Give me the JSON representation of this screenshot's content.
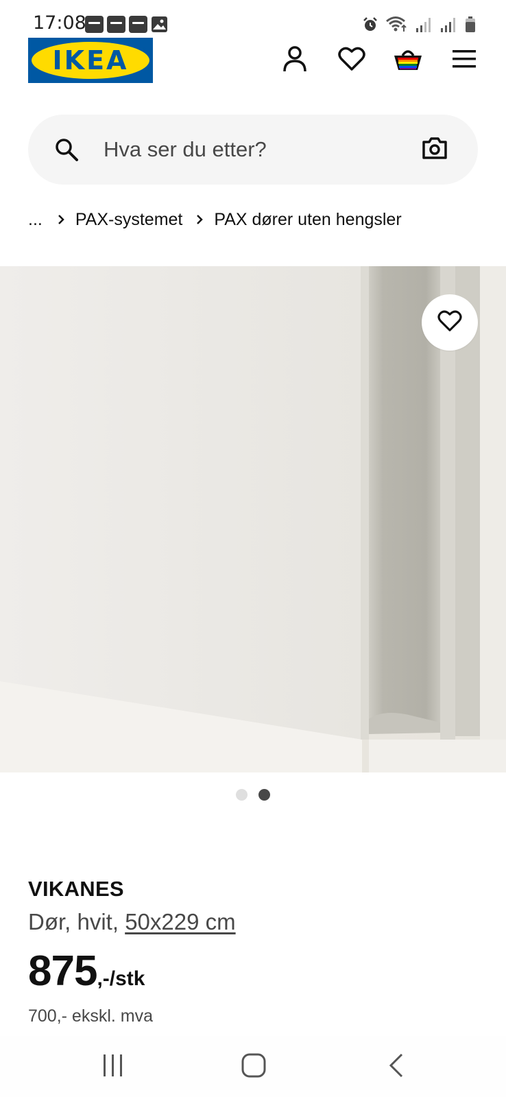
{
  "status_bar": {
    "time": "17:08",
    "notification_icons": [
      "kia-connect-icon",
      "kia-connect-icon",
      "kia-connect-icon",
      "image-icon"
    ],
    "right_icons": [
      "alarm-icon",
      "wifi-icon",
      "signal-icon",
      "signal-icon",
      "battery-icon"
    ]
  },
  "header": {
    "logo_text": "IKEA",
    "logo_mark": "®",
    "colors": {
      "brand_blue": "#0058a3",
      "brand_yellow": "#ffdb00"
    },
    "icons": [
      "account-icon",
      "heart-icon",
      "basket-icon",
      "menu-icon"
    ]
  },
  "search": {
    "placeholder": "Hva ser du etter?",
    "value": ""
  },
  "breadcrumb": {
    "ellipsis": "...",
    "items": [
      {
        "label": "PAX-systemet"
      },
      {
        "label": "PAX dører uten hengsler"
      }
    ]
  },
  "gallery": {
    "image_count": 2,
    "active_index": 1
  },
  "product": {
    "name": "VIKANES",
    "description": "Dør, hvit, ",
    "size": "50x229 cm",
    "price_integer": "875",
    "price_suffix": ",-/stk",
    "price_ex_vat": "700,- ekskl. mva"
  },
  "nav_bar": {
    "icons": [
      "recent-apps-icon",
      "home-icon",
      "back-icon"
    ]
  }
}
